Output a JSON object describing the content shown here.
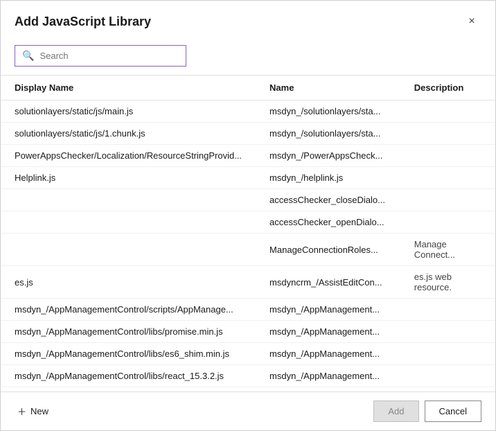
{
  "dialog": {
    "title": "Add JavaScript Library",
    "close_label": "×"
  },
  "search": {
    "placeholder": "Search",
    "value": ""
  },
  "table": {
    "columns": [
      {
        "key": "displayName",
        "label": "Display Name"
      },
      {
        "key": "name",
        "label": "Name"
      },
      {
        "key": "description",
        "label": "Description"
      }
    ],
    "rows": [
      {
        "displayName": "solutionlayers/static/js/main.js",
        "name": "msdyn_/solutionlayers/sta...",
        "description": ""
      },
      {
        "displayName": "solutionlayers/static/js/1.chunk.js",
        "name": "msdyn_/solutionlayers/sta...",
        "description": ""
      },
      {
        "displayName": "PowerAppsChecker/Localization/ResourceStringProvid...",
        "name": "msdyn_/PowerAppsCheck...",
        "description": ""
      },
      {
        "displayName": "Helplink.js",
        "name": "msdyn_/helplink.js",
        "description": ""
      },
      {
        "displayName": "",
        "name": "accessChecker_closeDialo...",
        "description": ""
      },
      {
        "displayName": "",
        "name": "accessChecker_openDialo...",
        "description": ""
      },
      {
        "displayName": "",
        "name": "ManageConnectionRoles...",
        "description": "Manage Connect..."
      },
      {
        "displayName": "es.js",
        "name": "msdyncrm_/AssistEditCon...",
        "description": "es.js web resource."
      },
      {
        "displayName": "msdyn_/AppManagementControl/scripts/AppManage...",
        "name": "msdyn_/AppManagement...",
        "description": ""
      },
      {
        "displayName": "msdyn_/AppManagementControl/libs/promise.min.js",
        "name": "msdyn_/AppManagement...",
        "description": ""
      },
      {
        "displayName": "msdyn_/AppManagementControl/libs/es6_shim.min.js",
        "name": "msdyn_/AppManagement...",
        "description": ""
      },
      {
        "displayName": "msdyn_/AppManagementControl/libs/react_15.3.2.js",
        "name": "msdyn_/AppManagement...",
        "description": ""
      }
    ]
  },
  "footer": {
    "new_label": "New",
    "add_label": "Add",
    "cancel_label": "Cancel"
  },
  "colors": {
    "accent": "#8661c5",
    "link": "#0078d4"
  }
}
